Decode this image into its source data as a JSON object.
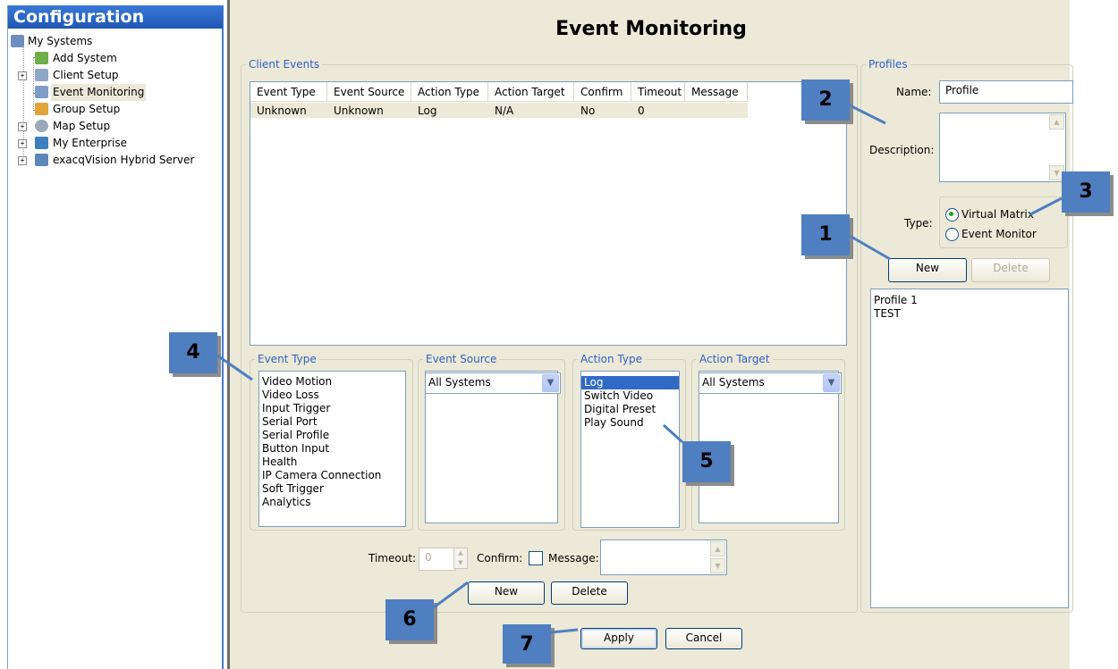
{
  "sidebar": {
    "title": "Configuration",
    "items": [
      {
        "label": "My Systems"
      },
      {
        "label": "Add System"
      },
      {
        "label": "Client Setup"
      },
      {
        "label": "Event Monitoring"
      },
      {
        "label": "Group Setup"
      },
      {
        "label": "Map Setup"
      },
      {
        "label": "My Enterprise"
      },
      {
        "label": "exacqVision Hybrid Server"
      }
    ]
  },
  "main": {
    "title": "Event Monitoring",
    "client_events": {
      "group_title": "Client Events",
      "columns": [
        "Event Type",
        "Event Source",
        "Action Type",
        "Action Target",
        "Confirm",
        "Timeout",
        "Message"
      ],
      "rows": [
        [
          "Unknown",
          "Unknown",
          "Log",
          "N/A",
          "No",
          "0",
          ""
        ]
      ]
    },
    "event_type": {
      "group_title": "Event Type",
      "items": [
        "Video Motion",
        "Video Loss",
        "Input Trigger",
        "Serial Port",
        "Serial Profile",
        "Button Input",
        "Health",
        "IP Camera Connection",
        "Soft Trigger",
        "Analytics"
      ]
    },
    "event_source": {
      "group_title": "Event Source",
      "selected": "All Systems"
    },
    "action_type": {
      "group_title": "Action Type",
      "items": [
        "Log",
        "Switch Video",
        "Digital Preset",
        "Play Sound"
      ],
      "selected_index": 0
    },
    "action_target": {
      "group_title": "Action Target",
      "selected": "All Systems"
    },
    "options": {
      "timeout_label": "Timeout:",
      "timeout_value": "0",
      "confirm_label": "Confirm:",
      "message_label": "Message:"
    },
    "buttons": {
      "new": "New",
      "delete": "Delete",
      "apply": "Apply",
      "cancel": "Cancel"
    }
  },
  "profiles": {
    "group_title": "Profiles",
    "name_label": "Name:",
    "name_value": "Profile",
    "description_label": "Description:",
    "type_label": "Type:",
    "type_options": [
      "Virtual Matrix",
      "Event Monitor"
    ],
    "type_selected": "Virtual Matrix",
    "new_label": "New",
    "delete_label": "Delete",
    "list": [
      "Profile 1",
      "TEST"
    ]
  },
  "callouts": [
    "1",
    "2",
    "3",
    "4",
    "5",
    "6",
    "7"
  ]
}
